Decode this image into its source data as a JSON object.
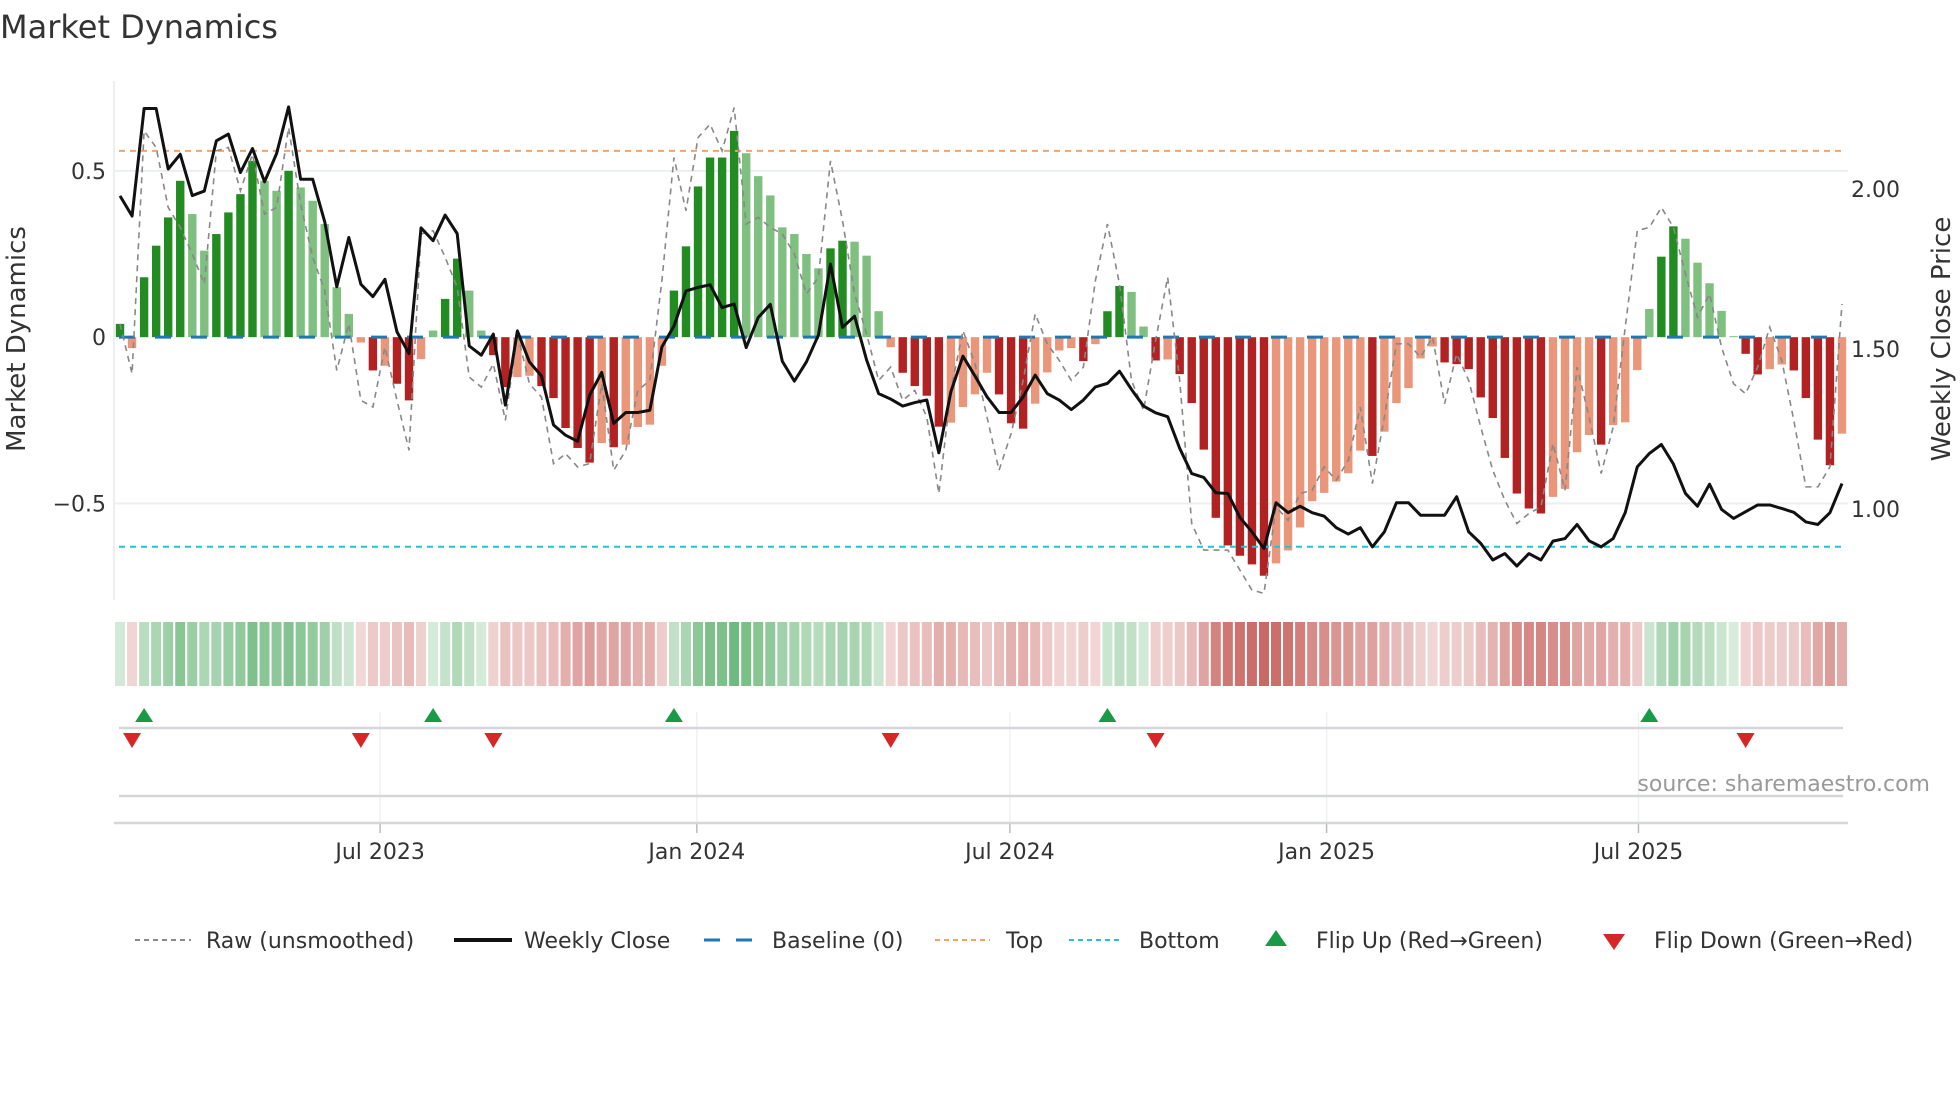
{
  "chart_data": {
    "type": "bar",
    "title": "Market Dynamics",
    "ylabel": "Market Dynamics",
    "y2label": "Weekly Close Price",
    "xlim": [
      -0.5,
      143.5
    ],
    "ylim": [
      -0.79,
      0.77
    ],
    "y2lim": [
      0.716,
      2.338
    ],
    "yticks": [
      {
        "v": 0.5,
        "label": "0.5"
      },
      {
        "v": 0,
        "label": "0"
      },
      {
        "v": -0.5,
        "label": "−0.5"
      }
    ],
    "y2ticks": [
      {
        "v": 2.0,
        "label": "2.00"
      },
      {
        "v": 1.5,
        "label": "1.50"
      },
      {
        "v": 1.0,
        "label": "1.00"
      }
    ],
    "xticks": [
      {
        "v": 21.6,
        "label": "Jul 2023"
      },
      {
        "v": 47.9,
        "label": "Jan 2024"
      },
      {
        "v": 73.9,
        "label": "Jul 2024"
      },
      {
        "v": 100.2,
        "label": "Jan 2025"
      },
      {
        "v": 126.1,
        "label": "Jul 2025"
      }
    ],
    "top_threshold": 0.56,
    "bottom_threshold": -0.63,
    "baseline": 0,
    "values": [
      0.04,
      -0.033,
      0.18,
      0.275,
      0.36,
      0.47,
      0.37,
      0.26,
      0.31,
      0.375,
      0.43,
      0.53,
      0.47,
      0.44,
      0.5,
      0.45,
      0.41,
      0.34,
      0.15,
      0.07,
      -0.016,
      -0.1,
      -0.086,
      -0.14,
      -0.19,
      -0.066,
      0.02,
      0.115,
      0.236,
      0.14,
      0.02,
      -0.054,
      -0.15,
      -0.12,
      -0.116,
      -0.147,
      -0.183,
      -0.273,
      -0.333,
      -0.377,
      -0.318,
      -0.331,
      -0.323,
      -0.27,
      -0.263,
      -0.086,
      0.14,
      0.273,
      0.453,
      0.54,
      0.54,
      0.62,
      0.553,
      0.484,
      0.426,
      0.33,
      0.31,
      0.25,
      0.207,
      0.267,
      0.29,
      0.287,
      0.245,
      0.078,
      -0.03,
      -0.107,
      -0.147,
      -0.176,
      -0.269,
      -0.257,
      -0.21,
      -0.172,
      -0.107,
      -0.172,
      -0.259,
      -0.275,
      -0.2,
      -0.106,
      -0.04,
      -0.033,
      -0.072,
      -0.021,
      0.078,
      0.154,
      0.136,
      0.032,
      -0.07,
      -0.067,
      -0.111,
      -0.198,
      -0.338,
      -0.543,
      -0.626,
      -0.657,
      -0.683,
      -0.717,
      -0.68,
      -0.641,
      -0.572,
      -0.493,
      -0.468,
      -0.434,
      -0.409,
      -0.341,
      -0.357,
      -0.284,
      -0.198,
      -0.153,
      -0.064,
      -0.028,
      -0.076,
      -0.081,
      -0.096,
      -0.181,
      -0.243,
      -0.363,
      -0.47,
      -0.515,
      -0.53,
      -0.48,
      -0.456,
      -0.346,
      -0.294,
      -0.323,
      -0.264,
      -0.256,
      -0.099,
      0.085,
      0.242,
      0.333,
      0.296,
      0.224,
      0.162,
      0.079,
      0.003,
      -0.05,
      -0.112,
      -0.096,
      -0.082,
      -0.1,
      -0.183,
      -0.308,
      -0.385,
      -0.29
    ],
    "close": [
      1.979,
      1.916,
      2.252,
      2.252,
      2.063,
      2.109,
      1.98,
      1.994,
      2.151,
      2.172,
      2.052,
      2.127,
      2.023,
      2.111,
      2.257,
      2.031,
      2.031,
      1.898,
      1.695,
      1.849,
      1.703,
      1.664,
      1.718,
      1.554,
      1.486,
      1.879,
      1.839,
      1.919,
      1.861,
      1.51,
      1.481,
      1.547,
      1.325,
      1.557,
      1.46,
      1.416,
      1.263,
      1.231,
      1.212,
      1.356,
      1.427,
      1.268,
      1.302,
      1.302,
      1.309,
      1.507,
      1.572,
      1.682,
      1.693,
      1.701,
      1.63,
      1.641,
      1.505,
      1.599,
      1.64,
      1.462,
      1.4,
      1.46,
      1.544,
      1.766,
      1.568,
      1.603,
      1.466,
      1.361,
      1.344,
      1.322,
      1.333,
      1.341,
      1.176,
      1.367,
      1.478,
      1.416,
      1.351,
      1.302,
      1.302,
      1.351,
      1.419,
      1.361,
      1.341,
      1.311,
      1.341,
      1.382,
      1.393,
      1.431,
      1.374,
      1.322,
      1.301,
      1.289,
      1.19,
      1.111,
      1.099,
      1.051,
      1.049,
      0.974,
      0.929,
      0.877,
      1.02,
      0.989,
      1.009,
      0.989,
      0.978,
      0.942,
      0.922,
      0.942,
      0.882,
      0.929,
      1.02,
      1.02,
      0.981,
      0.981,
      0.981,
      1.039,
      0.929,
      0.893,
      0.841,
      0.861,
      0.822,
      0.861,
      0.841,
      0.9,
      0.908,
      0.952,
      0.901,
      0.882,
      0.908,
      0.989,
      1.132,
      1.174,
      1.202,
      1.141,
      1.049,
      1.009,
      1.078,
      0.999,
      0.971,
      0.992,
      1.013,
      1.013,
      1.002,
      0.99,
      0.96,
      0.952,
      0.989,
      1.08
    ],
    "raw": [
      0.04,
      -0.11,
      0.62,
      0.57,
      0.39,
      0.33,
      0.25,
      0.16,
      0.56,
      0.57,
      0.44,
      0.55,
      0.37,
      0.39,
      0.63,
      0.4,
      0.24,
      0.14,
      -0.1,
      0.04,
      -0.19,
      -0.21,
      -0.03,
      -0.19,
      -0.34,
      0.31,
      0.32,
      0.24,
      0.15,
      -0.12,
      -0.15,
      -0.08,
      -0.25,
      0.01,
      -0.14,
      -0.18,
      -0.38,
      -0.35,
      -0.39,
      -0.38,
      -0.14,
      -0.4,
      -0.34,
      -0.16,
      -0.13,
      0.17,
      0.54,
      0.38,
      0.6,
      0.64,
      0.56,
      0.69,
      0.34,
      0.36,
      0.33,
      0.31,
      0.25,
      0.13,
      0.18,
      0.53,
      0.35,
      0.13,
      0.01,
      -0.13,
      -0.09,
      -0.19,
      -0.16,
      -0.24,
      -0.47,
      -0.16,
      0.02,
      -0.08,
      -0.24,
      -0.4,
      -0.29,
      -0.13,
      0.07,
      -0.02,
      -0.07,
      -0.13,
      -0.09,
      0.17,
      0.34,
      0.16,
      -0.13,
      -0.22,
      -0.01,
      0.18,
      -0.13,
      -0.56,
      -0.64,
      -0.64,
      -0.64,
      -0.7,
      -0.76,
      -0.77,
      -0.51,
      -0.55,
      -0.47,
      -0.46,
      -0.39,
      -0.43,
      -0.37,
      -0.21,
      -0.44,
      -0.24,
      -0.02,
      -0.02,
      -0.06,
      0.0,
      -0.2,
      -0.05,
      -0.13,
      -0.27,
      -0.4,
      -0.49,
      -0.56,
      -0.53,
      -0.51,
      -0.32,
      -0.46,
      -0.09,
      -0.24,
      -0.41,
      -0.27,
      0.03,
      0.32,
      0.33,
      0.39,
      0.33,
      0.19,
      0.06,
      0.13,
      -0.03,
      -0.14,
      -0.17,
      -0.09,
      0.03,
      -0.07,
      -0.25,
      -0.45,
      -0.45,
      -0.39,
      0.1
    ],
    "legend": {
      "placement": "bottom",
      "raw": "Raw (unsmoothed)",
      "close": "Weekly Close",
      "baseline": "Baseline (0)",
      "top": "Top",
      "bottom": "Bottom",
      "flip_up": "Flip Up (Red→Green)",
      "flip_down": "Flip Down (Green→Red)"
    },
    "source": "source: sharemaestro.com"
  },
  "colors": {
    "pos_strong": "#228b22",
    "pos_weak": "#7fbf7f",
    "neg_strong": "#b22222",
    "neg_weak": "#e9967a",
    "close": "#111111",
    "raw": "#888888",
    "baseline": "#1f77b4",
    "top": "#f4a460",
    "bottom": "#22c3d6",
    "flip_up": "#1a9a48",
    "flip_down": "#d62728"
  }
}
